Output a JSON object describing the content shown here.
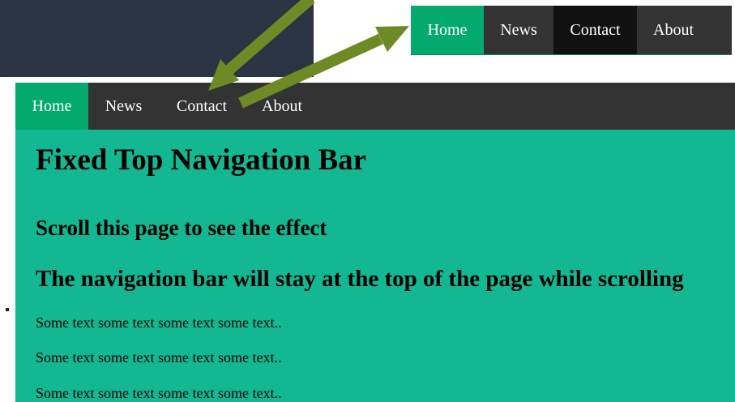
{
  "colors": {
    "accent_green": "#04aa6d",
    "content_background": "#13b893",
    "nav_background": "#333333",
    "nav_hover_background": "#111111",
    "arrow_color": "#6d8a25",
    "dark_panel": "#2a3442"
  },
  "inset_nav": {
    "items": [
      "Home",
      "News",
      "Contact",
      "About"
    ],
    "active": "Home",
    "hovered": "Contact"
  },
  "main_nav": {
    "items": [
      "Home",
      "News",
      "Contact",
      "About"
    ],
    "active": "Home"
  },
  "content": {
    "title": "Fixed Top Navigation Bar",
    "subtitle": "Scroll this page to see the effect",
    "subtitle2": "The navigation bar will stay at the top of the page while scrolling",
    "paragraphs": [
      "Some text some text some text some text..",
      "Some text some text some text some text..",
      "Some text some text some text some text.."
    ]
  }
}
